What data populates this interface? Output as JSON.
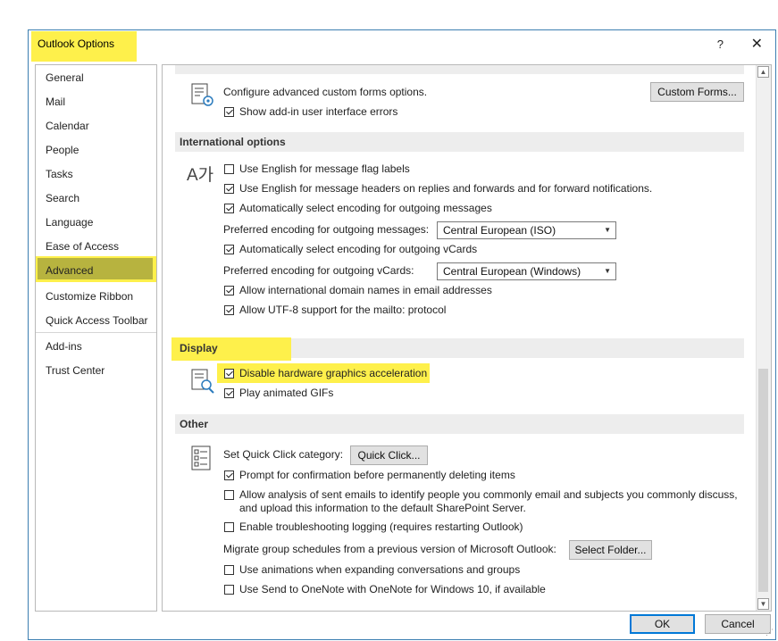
{
  "window": {
    "title": "Outlook Options",
    "help": "?",
    "close": "✕"
  },
  "nav": {
    "items": [
      "General",
      "Mail",
      "Calendar",
      "People",
      "Tasks",
      "Search",
      "Language",
      "Ease of Access",
      "Advanced",
      "Customize Ribbon",
      "Quick Access Toolbar",
      "Add-ins",
      "Trust Center"
    ],
    "active": "Advanced"
  },
  "forms": {
    "label": "Configure advanced custom forms options.",
    "button": "Custom Forms...",
    "addin_errors": "Show add-in user interface errors"
  },
  "international": {
    "heading": "International options",
    "icon_glyph": "A가",
    "english_flag": "Use English for message flag labels",
    "english_headers": "Use English for message headers on replies and forwards and for forward notifications.",
    "auto_encoding": "Automatically select encoding for outgoing messages",
    "pref_encoding_label": "Preferred encoding for outgoing messages:",
    "pref_encoding_value": "Central European (ISO)",
    "auto_vcard": "Automatically select encoding for outgoing vCards",
    "pref_vcard_label": "Preferred encoding for outgoing vCards:",
    "pref_vcard_value": "Central European (Windows)",
    "intl_domains": "Allow international domain names in email addresses",
    "utf8": "Allow UTF-8 support for the mailto: protocol"
  },
  "display": {
    "heading": "Display",
    "hw_accel": "Disable hardware graphics acceleration",
    "gifs": "Play animated GIFs"
  },
  "other": {
    "heading": "Other",
    "quick_click_label": "Set Quick Click category:",
    "quick_click_button": "Quick Click...",
    "prompt_delete": "Prompt for confirmation before permanently deleting items",
    "allow_analysis_1": "Allow analysis of sent emails to identify people you commonly email and subjects you commonly discuss,",
    "allow_analysis_2": "and upload this information to the default SharePoint Server.",
    "troubleshoot": "Enable troubleshooting logging (requires restarting Outlook)",
    "migrate_label": "Migrate group schedules from a previous version of Microsoft Outlook:",
    "select_folder": "Select Folder...",
    "animations": "Use animations when expanding conversations and groups",
    "onenote": "Use Send to OneNote with OneNote for Windows 10, if available"
  },
  "footer": {
    "ok": "OK",
    "cancel": "Cancel"
  },
  "colors": {
    "highlight": "#fef04b",
    "active_nav": "#b7b33f",
    "accent": "#0078d7"
  }
}
